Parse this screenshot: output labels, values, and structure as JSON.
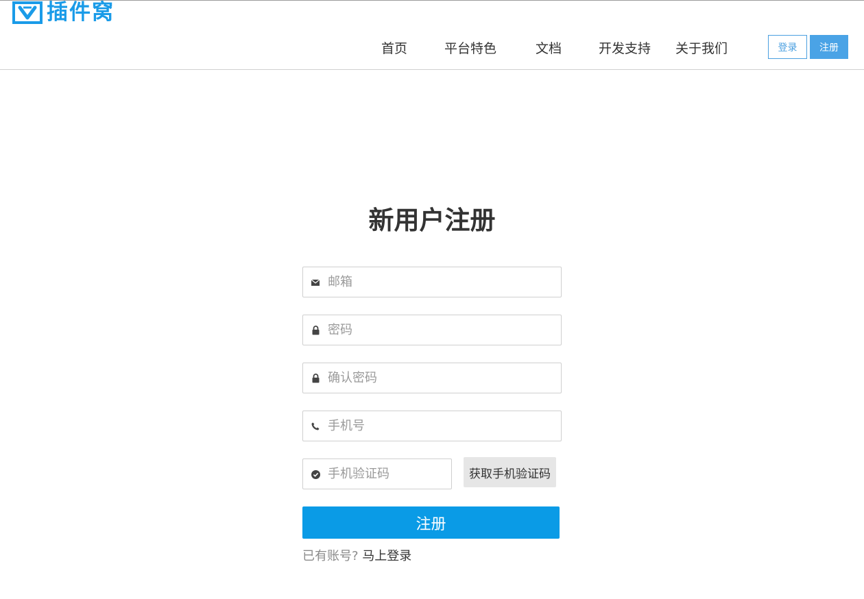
{
  "header": {
    "logo_text": "插件窝",
    "nav": [
      "首页",
      "平台特色",
      "文档",
      "开发支持",
      "关于我们"
    ],
    "login_label": "登录",
    "register_label": "注册"
  },
  "form": {
    "title": "新用户注册",
    "email": {
      "placeholder": "邮箱",
      "icon": "envelope-icon",
      "value": ""
    },
    "password": {
      "placeholder": "密码",
      "icon": "lock-icon",
      "value": ""
    },
    "confirm_password": {
      "placeholder": "确认密码",
      "icon": "lock-icon",
      "value": ""
    },
    "phone": {
      "placeholder": "手机号",
      "icon": "phone-icon",
      "value": ""
    },
    "sms_code": {
      "placeholder": "手机验证码",
      "icon": "check-circle-icon",
      "value": ""
    },
    "get_code_label": "获取手机验证码",
    "submit_label": "注册",
    "have_account_text": "已有账号?",
    "login_link_text": "马上登录"
  },
  "colors": {
    "accent": "#0a9be6",
    "logo_blue": "#1a9be8",
    "header_register_bg": "#4aa3e6"
  }
}
